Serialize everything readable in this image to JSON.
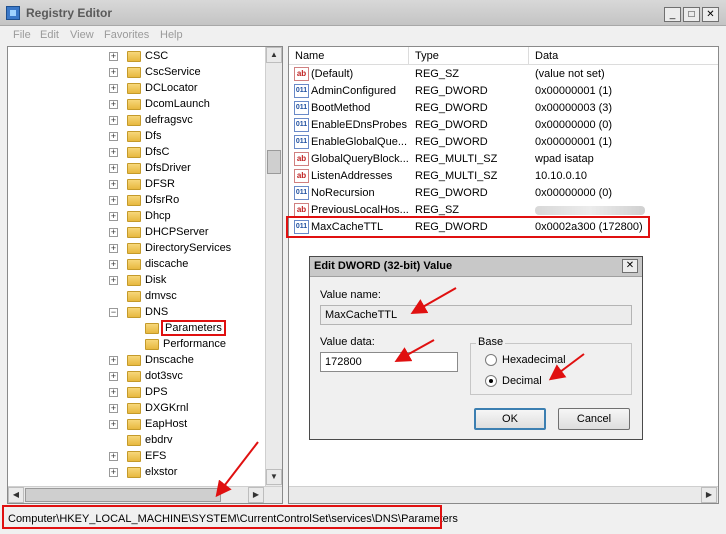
{
  "window": {
    "title": "Registry Editor",
    "minimize_glyph": "_",
    "maximize_glyph": "□",
    "close_glyph": "✕"
  },
  "menu": [
    "File",
    "Edit",
    "View",
    "Favorites",
    "Help"
  ],
  "tree": {
    "items": [
      {
        "label": "CSC",
        "expander": "+",
        "level": 0
      },
      {
        "label": "CscService",
        "expander": "+",
        "level": 0
      },
      {
        "label": "DCLocator",
        "expander": "+",
        "level": 0
      },
      {
        "label": "DcomLaunch",
        "expander": "+",
        "level": 0
      },
      {
        "label": "defragsvc",
        "expander": "+",
        "level": 0
      },
      {
        "label": "Dfs",
        "expander": "+",
        "level": 0
      },
      {
        "label": "DfsC",
        "expander": "+",
        "level": 0
      },
      {
        "label": "DfsDriver",
        "expander": "+",
        "level": 0
      },
      {
        "label": "DFSR",
        "expander": "+",
        "level": 0
      },
      {
        "label": "DfsrRo",
        "expander": "+",
        "level": 0
      },
      {
        "label": "Dhcp",
        "expander": "+",
        "level": 0
      },
      {
        "label": "DHCPServer",
        "expander": "+",
        "level": 0
      },
      {
        "label": "DirectoryServices",
        "expander": "+",
        "level": 0
      },
      {
        "label": "discache",
        "expander": "+",
        "level": 0
      },
      {
        "label": "Disk",
        "expander": "+",
        "level": 0
      },
      {
        "label": "dmvsc",
        "expander": "",
        "level": 0
      },
      {
        "label": "DNS",
        "expander": "−",
        "level": 0
      },
      {
        "label": "Parameters",
        "expander": "",
        "level": 1
      },
      {
        "label": "Performance",
        "expander": "",
        "level": 1
      },
      {
        "label": "Dnscache",
        "expander": "+",
        "level": 0
      },
      {
        "label": "dot3svc",
        "expander": "+",
        "level": 0
      },
      {
        "label": "DPS",
        "expander": "+",
        "level": 0
      },
      {
        "label": "DXGKrnl",
        "expander": "+",
        "level": 0
      },
      {
        "label": "EapHost",
        "expander": "+",
        "level": 0
      },
      {
        "label": "ebdrv",
        "expander": "",
        "level": 0
      },
      {
        "label": "EFS",
        "expander": "+",
        "level": 0
      },
      {
        "label": "elxstor",
        "expander": "+",
        "level": 0
      }
    ],
    "selected": "Parameters"
  },
  "list": {
    "headers": {
      "name": "Name",
      "type": "Type",
      "data": "Data"
    },
    "rows": [
      {
        "icon": "ab",
        "name": "(Default)",
        "type": "REG_SZ",
        "data": "(value not set)"
      },
      {
        "icon": "dword",
        "name": "AdminConfigured",
        "type": "REG_DWORD",
        "data": "0x00000001 (1)"
      },
      {
        "icon": "dword",
        "name": "BootMethod",
        "type": "REG_DWORD",
        "data": "0x00000003 (3)"
      },
      {
        "icon": "dword",
        "name": "EnableEDnsProbes",
        "type": "REG_DWORD",
        "data": "0x00000000 (0)"
      },
      {
        "icon": "dword",
        "name": "EnableGlobalQue...",
        "type": "REG_DWORD",
        "data": "0x00000001 (1)"
      },
      {
        "icon": "ab",
        "name": "GlobalQueryBlock...",
        "type": "REG_MULTI_SZ",
        "data": "wpad isatap"
      },
      {
        "icon": "ab",
        "name": "ListenAddresses",
        "type": "REG_MULTI_SZ",
        "data": "10.10.0.10"
      },
      {
        "icon": "dword",
        "name": "NoRecursion",
        "type": "REG_DWORD",
        "data": "0x00000000 (0)"
      },
      {
        "icon": "ab",
        "name": "PreviousLocalHos...",
        "type": "REG_SZ",
        "data": ""
      },
      {
        "icon": "dword",
        "name": "MaxCacheTTL",
        "type": "REG_DWORD",
        "data": "0x0002a300 (172800)"
      }
    ],
    "icon_labels": {
      "ab": "ab",
      "dword": "011"
    }
  },
  "dialog": {
    "title": "Edit DWORD (32-bit) Value",
    "close_glyph": "✕",
    "value_name_label": "Value name:",
    "value_name": "MaxCacheTTL",
    "value_data_label": "Value data:",
    "value_data": "172800",
    "base_label": "Base",
    "base_options": [
      {
        "label": "Hexadecimal",
        "selected": false
      },
      {
        "label": "Decimal",
        "selected": true
      }
    ],
    "ok_label": "OK",
    "cancel_label": "Cancel"
  },
  "status": {
    "path": "Computer\\HKEY_LOCAL_MACHINE\\SYSTEM\\CurrentControlSet\\services\\DNS\\Parameters"
  },
  "scroll_glyphs": {
    "up": "▲",
    "down": "▼",
    "left": "◀",
    "right": "▶"
  },
  "colors": {
    "annotation_red": "#e01010",
    "folder": "#e7b83f"
  }
}
